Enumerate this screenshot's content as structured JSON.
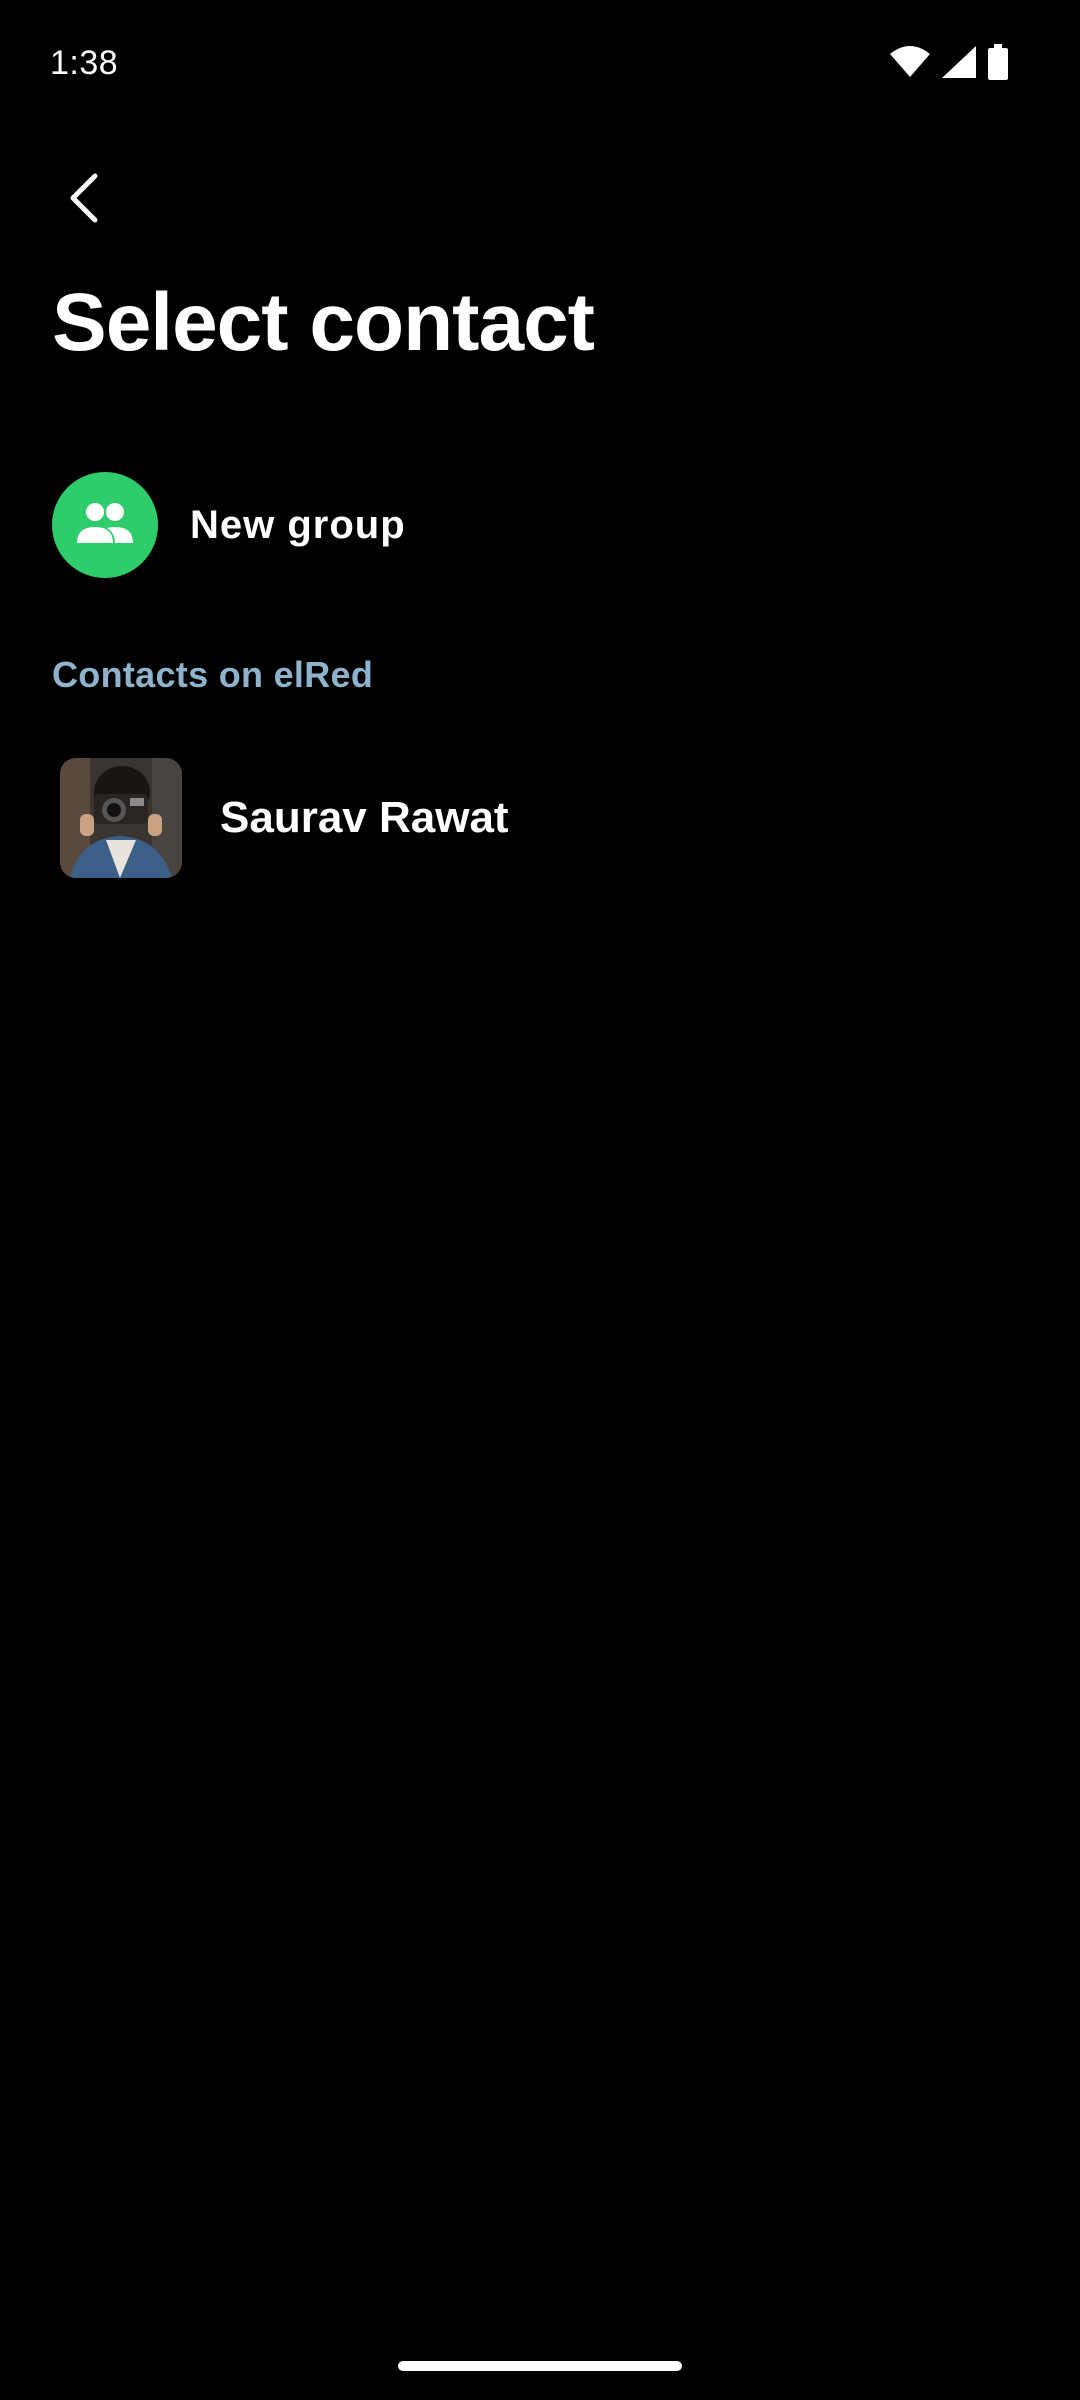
{
  "status_bar": {
    "time": "1:38",
    "icons": [
      "wifi-icon",
      "signal-icon",
      "battery-icon"
    ]
  },
  "header": {
    "back_icon": "chevron-left-icon",
    "title": "Select contact"
  },
  "new_group": {
    "icon": "group-icon",
    "label": "New group",
    "accent_color": "#2ecc6b"
  },
  "contacts_section": {
    "header": "Contacts on elRed",
    "header_color": "#8fb3cc",
    "contacts": [
      {
        "name": "Saurav Rawat",
        "avatar": "person-with-camera-photo"
      }
    ]
  }
}
